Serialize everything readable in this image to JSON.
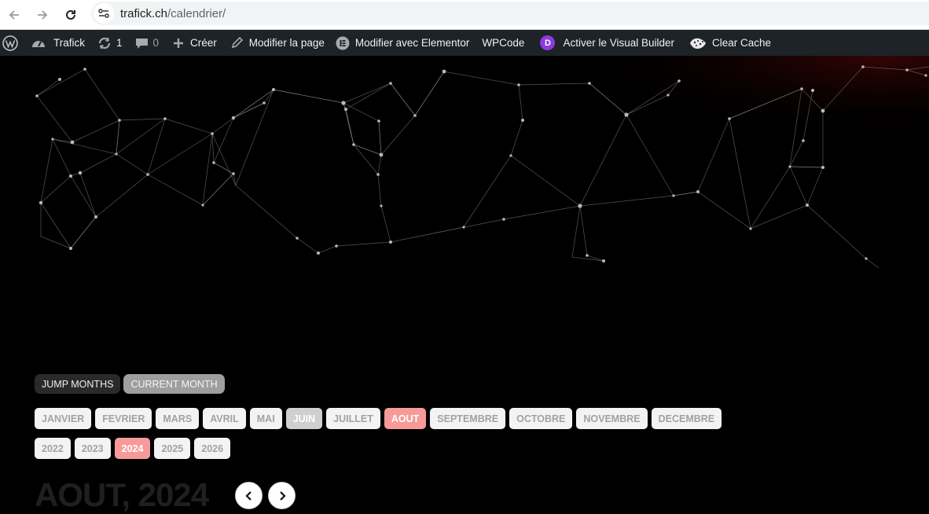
{
  "browser": {
    "back_icon": "arrow-left-icon",
    "forward_icon": "arrow-right-icon",
    "reload_icon": "reload-icon",
    "url_domain": "trafick.ch",
    "url_path": "/calendrier/"
  },
  "admin_bar": {
    "site_name": "Trafick",
    "updates_count": "1",
    "comments_count": "0",
    "create_label": "Créer",
    "edit_page_label": "Modifier la page",
    "elementor_label": "Modifier avec Elementor",
    "wpcode_label": "WPCode",
    "divi_badge": "D",
    "visual_builder_label": "Activer le Visual Builder",
    "clear_cache_label": "Clear Cache"
  },
  "calendar": {
    "modes": [
      "JUMP MONTHS",
      "CURRENT MONTH"
    ],
    "months": [
      "JANVIER",
      "FEVRIER",
      "MARS",
      "AVRIL",
      "MAI",
      "JUIN",
      "JUILLET",
      "AOUT",
      "SEPTEMBRE",
      "OCTOBRE",
      "NOVEMBRE",
      "DECEMBRE"
    ],
    "current_month": "JUIN",
    "selected_month": "AOUT",
    "years": [
      "2022",
      "2023",
      "2024",
      "2025",
      "2026"
    ],
    "selected_year": "2024",
    "heading": "AOUT, 2024"
  },
  "colors": {
    "selected_red": "#f79a9a",
    "current_grey": "#cfcfcf",
    "admin_bar": "#1d2327"
  }
}
